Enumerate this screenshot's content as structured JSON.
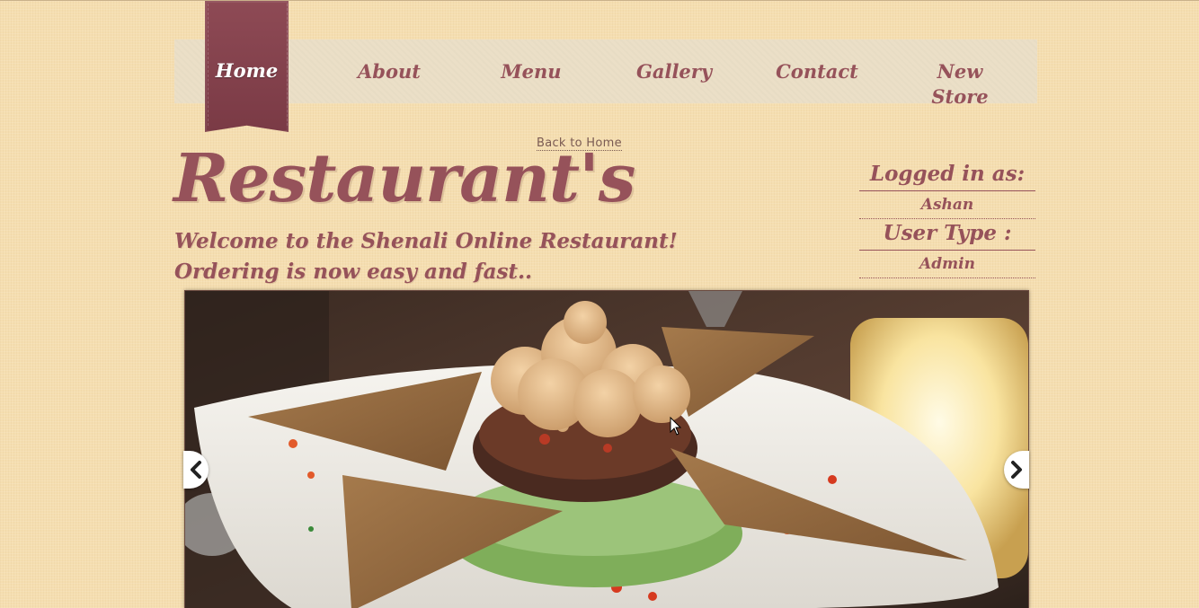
{
  "nav": {
    "items": [
      {
        "id": "home",
        "label": "Home",
        "active": true
      },
      {
        "id": "about",
        "label": "About"
      },
      {
        "id": "menu",
        "label": "Menu"
      },
      {
        "id": "gallery",
        "label": "Gallery"
      },
      {
        "id": "contact",
        "label": "Contact"
      },
      {
        "id": "newstore",
        "label": "New Store"
      }
    ]
  },
  "header": {
    "back_link": "Back to Home",
    "title": "Restaurant's",
    "welcome_line1": "Welcome to the Shenali Online Restaurant!",
    "welcome_line2": "Ordering is now easy and fast.."
  },
  "user_panel": {
    "logged_in_label": "Logged in as:",
    "username": "Ashan",
    "user_type_label": "User Type :",
    "user_type": "Admin"
  },
  "slider": {
    "prev_icon": "chevron-left-icon",
    "next_icon": "chevron-right-icon"
  },
  "colors": {
    "page_bg": "#f5deb0",
    "accent": "#96525a",
    "ribbon": "#7d3f4a",
    "nav_bg": "#ebdfc7"
  }
}
